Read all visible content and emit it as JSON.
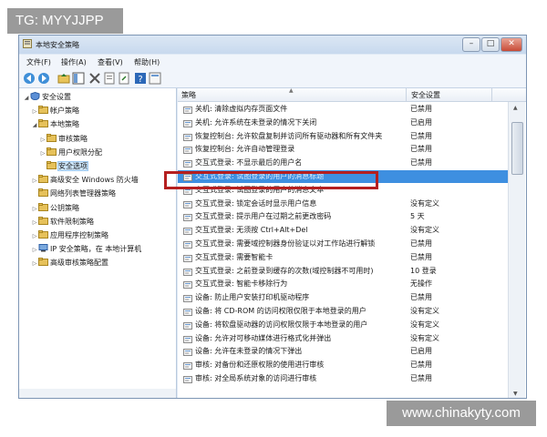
{
  "watermarks": {
    "top": "TG: MYYJJPP",
    "bottom": "www.chinakyty.com"
  },
  "window": {
    "title": "本地安全策略"
  },
  "menu": [
    "文件(F)",
    "操作(A)",
    "查看(V)",
    "帮助(H)"
  ],
  "tree": [
    {
      "label": "安全设置",
      "indent": 0,
      "expander": "◢",
      "icon": "shield-icon",
      "selected": false
    },
    {
      "label": "帐户策略",
      "indent": 1,
      "expander": "▷",
      "icon": "folder-icon",
      "selected": false
    },
    {
      "label": "本地策略",
      "indent": 1,
      "expander": "◢",
      "icon": "folder-icon",
      "selected": false
    },
    {
      "label": "审核策略",
      "indent": 2,
      "expander": "▷",
      "icon": "folder-icon",
      "selected": false
    },
    {
      "label": "用户权限分配",
      "indent": 2,
      "expander": "▷",
      "icon": "folder-icon",
      "selected": false
    },
    {
      "label": "安全选项",
      "indent": 2,
      "expander": "",
      "icon": "folder-icon",
      "selected": true
    },
    {
      "label": "高级安全 Windows 防火墙",
      "indent": 1,
      "expander": "▷",
      "icon": "folder-icon",
      "selected": false
    },
    {
      "label": "网络列表管理器策略",
      "indent": 1,
      "expander": "",
      "icon": "folder-icon",
      "selected": false
    },
    {
      "label": "公钥策略",
      "indent": 1,
      "expander": "▷",
      "icon": "folder-icon",
      "selected": false
    },
    {
      "label": "软件限制策略",
      "indent": 1,
      "expander": "▷",
      "icon": "folder-icon",
      "selected": false
    },
    {
      "label": "应用程序控制策略",
      "indent": 1,
      "expander": "▷",
      "icon": "folder-icon",
      "selected": false
    },
    {
      "label": "IP 安全策略，在 本地计算机",
      "indent": 1,
      "expander": "▷",
      "icon": "network-icon",
      "selected": false
    },
    {
      "label": "高级审核策略配置",
      "indent": 1,
      "expander": "▷",
      "icon": "folder-icon",
      "selected": false
    }
  ],
  "list": {
    "columns": [
      "策略",
      "安全设置"
    ],
    "rows": [
      {
        "policy": "关机: 清除虚拟内存页面文件",
        "setting": "已禁用",
        "selected": false
      },
      {
        "policy": "关机: 允许系统在未登录的情况下关闭",
        "setting": "已启用",
        "selected": false
      },
      {
        "policy": "恢复控制台: 允许软盘复制并访问所有驱动器和所有文件夹",
        "setting": "已禁用",
        "selected": false
      },
      {
        "policy": "恢复控制台: 允许自动管理登录",
        "setting": "已禁用",
        "selected": false
      },
      {
        "policy": "交互式登录: 不显示最后的用户名",
        "setting": "已禁用",
        "selected": false
      },
      {
        "policy": "交互式登录: 试图登录的用户的消息标题",
        "setting": "",
        "selected": true
      },
      {
        "policy": "交互式登录: 试图登录的用户的消息文本",
        "setting": "",
        "selected": false
      },
      {
        "policy": "交互式登录: 锁定会话时显示用户信息",
        "setting": "没有定义",
        "selected": false
      },
      {
        "policy": "交互式登录: 提示用户在过期之前更改密码",
        "setting": "5 天",
        "selected": false
      },
      {
        "policy": "交互式登录: 无须按 Ctrl+Alt+Del",
        "setting": "没有定义",
        "selected": false
      },
      {
        "policy": "交互式登录: 需要域控制器身份验证以对工作站进行解锁",
        "setting": "已禁用",
        "selected": false
      },
      {
        "policy": "交互式登录: 需要智能卡",
        "setting": "已禁用",
        "selected": false
      },
      {
        "policy": "交互式登录: 之前登录到缓存的次数(域控制器不可用时)",
        "setting": "10 登录",
        "selected": false
      },
      {
        "policy": "交互式登录: 智能卡移除行为",
        "setting": "无操作",
        "selected": false
      },
      {
        "policy": "设备: 防止用户安装打印机驱动程序",
        "setting": "已禁用",
        "selected": false
      },
      {
        "policy": "设备: 将 CD-ROM 的访问权限仅限于本地登录的用户",
        "setting": "没有定义",
        "selected": false
      },
      {
        "policy": "设备: 将软盘驱动器的访问权限仅限于本地登录的用户",
        "setting": "没有定义",
        "selected": false
      },
      {
        "policy": "设备: 允许对可移动媒体进行格式化并弹出",
        "setting": "没有定义",
        "selected": false
      },
      {
        "policy": "设备: 允许在未登录的情况下弹出",
        "setting": "已启用",
        "selected": false
      },
      {
        "policy": "审核: 对备份和还原权限的使用进行审核",
        "setting": "已禁用",
        "selected": false
      },
      {
        "policy": "审核: 对全局系统对象的访问进行审核",
        "setting": "已禁用",
        "selected": false
      }
    ]
  },
  "colors": {
    "selection": "#3e8fe0",
    "highlight_box": "#b51f1f"
  }
}
